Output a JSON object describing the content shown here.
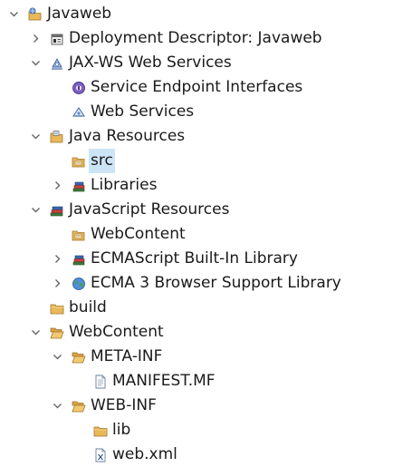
{
  "tree": {
    "root": {
      "label": "Javaweb",
      "icon": "web-project-icon",
      "expanded": true
    },
    "deployment_descriptor": {
      "label": "Deployment Descriptor: Javaweb",
      "icon": "deployment-descriptor-icon",
      "expanded": false
    },
    "jaxws": {
      "label": "JAX-WS Web Services",
      "icon": "web-services-icon",
      "expanded": true
    },
    "sei": {
      "label": "Service Endpoint Interfaces",
      "icon": "interface-icon"
    },
    "webservices": {
      "label": "Web Services",
      "icon": "web-service-icon"
    },
    "java_resources": {
      "label": "Java Resources",
      "icon": "java-resources-icon",
      "expanded": true
    },
    "src": {
      "label": "src",
      "icon": "source-folder-icon",
      "selected": true
    },
    "libraries": {
      "label": "Libraries",
      "icon": "libraries-icon",
      "expanded": false
    },
    "js_resources": {
      "label": "JavaScript Resources",
      "icon": "javascript-resources-icon",
      "expanded": true
    },
    "js_webcontent": {
      "label": "WebContent",
      "icon": "source-folder-icon"
    },
    "ecma_builtin": {
      "label": "ECMAScript Built-In Library",
      "icon": "libraries-icon",
      "expanded": false
    },
    "ecma3_browser": {
      "label": "ECMA 3 Browser Support Library",
      "icon": "globe-icon",
      "expanded": false
    },
    "build": {
      "label": "build",
      "icon": "folder-icon"
    },
    "webcontent": {
      "label": "WebContent",
      "icon": "folder-open-icon",
      "expanded": true
    },
    "metainf": {
      "label": "META-INF",
      "icon": "folder-open-icon",
      "expanded": true
    },
    "manifest": {
      "label": "MANIFEST.MF",
      "icon": "text-file-icon"
    },
    "webinf": {
      "label": "WEB-INF",
      "icon": "folder-open-icon",
      "expanded": true
    },
    "lib": {
      "label": "lib",
      "icon": "folder-icon"
    },
    "webxml": {
      "label": "web.xml",
      "icon": "xml-file-icon"
    }
  },
  "colors": {
    "selection": "#cce4f7",
    "folder": "#e8b85a",
    "toggle": "#666666",
    "text": "#1a1a1a"
  }
}
